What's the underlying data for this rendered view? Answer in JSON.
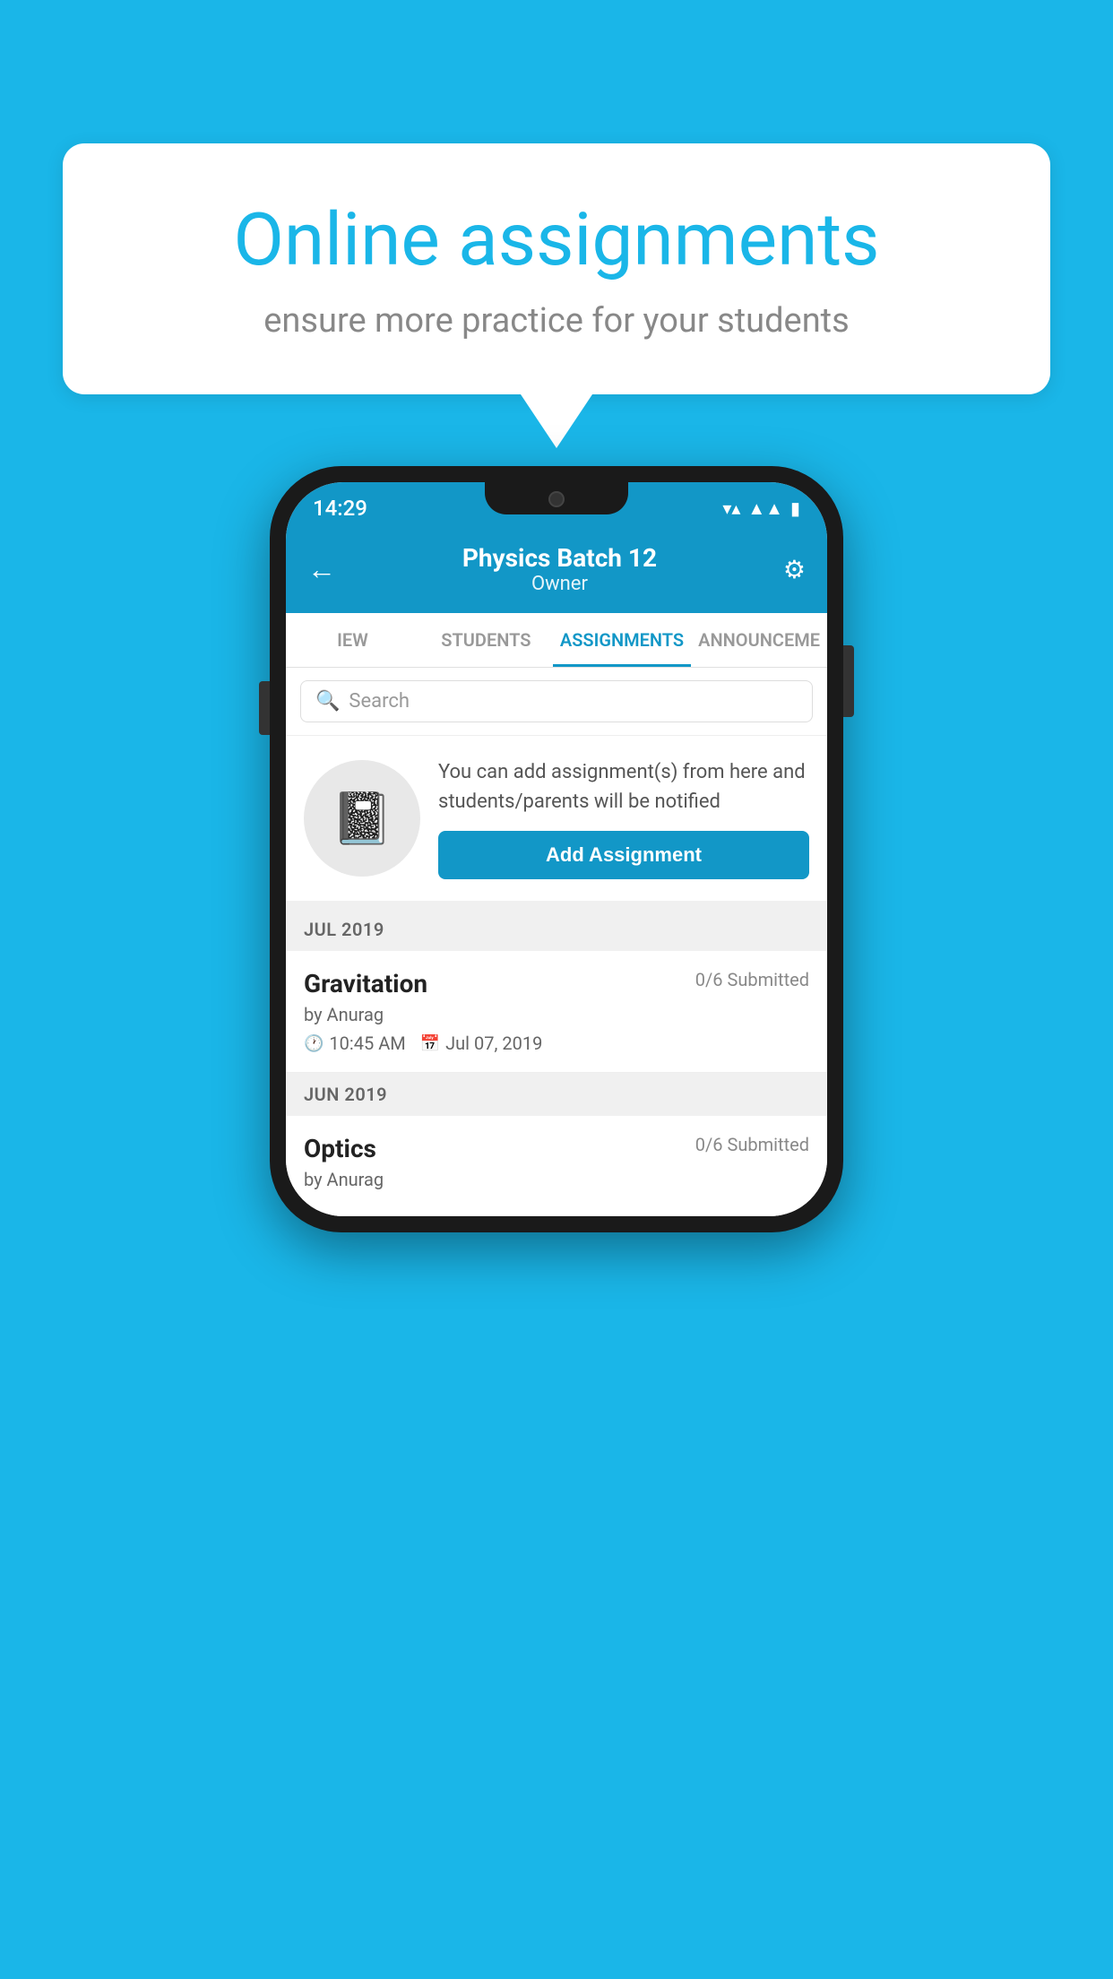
{
  "background_color": "#1ab6e8",
  "speech_bubble": {
    "title": "Online assignments",
    "subtitle": "ensure more practice for your students"
  },
  "status_bar": {
    "time": "14:29",
    "wifi_icon": "▼▲",
    "signal_icon": "▲▲",
    "battery_icon": "▮"
  },
  "header": {
    "title": "Physics Batch 12",
    "subtitle": "Owner",
    "back_label": "←",
    "settings_label": "⚙"
  },
  "tabs": [
    {
      "label": "IEW",
      "active": false
    },
    {
      "label": "STUDENTS",
      "active": false
    },
    {
      "label": "ASSIGNMENTS",
      "active": true
    },
    {
      "label": "ANNOUNCEMENTS",
      "active": false
    }
  ],
  "search": {
    "placeholder": "Search"
  },
  "promo": {
    "icon": "📓",
    "text": "You can add assignment(s) from here and students/parents will be notified",
    "button_label": "Add Assignment"
  },
  "sections": [
    {
      "month": "JUL 2019",
      "assignments": [
        {
          "title": "Gravitation",
          "submitted": "0/6 Submitted",
          "author": "by Anurag",
          "time": "10:45 AM",
          "date": "Jul 07, 2019"
        }
      ]
    },
    {
      "month": "JUN 2019",
      "assignments": [
        {
          "title": "Optics",
          "submitted": "0/6 Submitted",
          "author": "by Anurag",
          "time": "",
          "date": ""
        }
      ]
    }
  ]
}
